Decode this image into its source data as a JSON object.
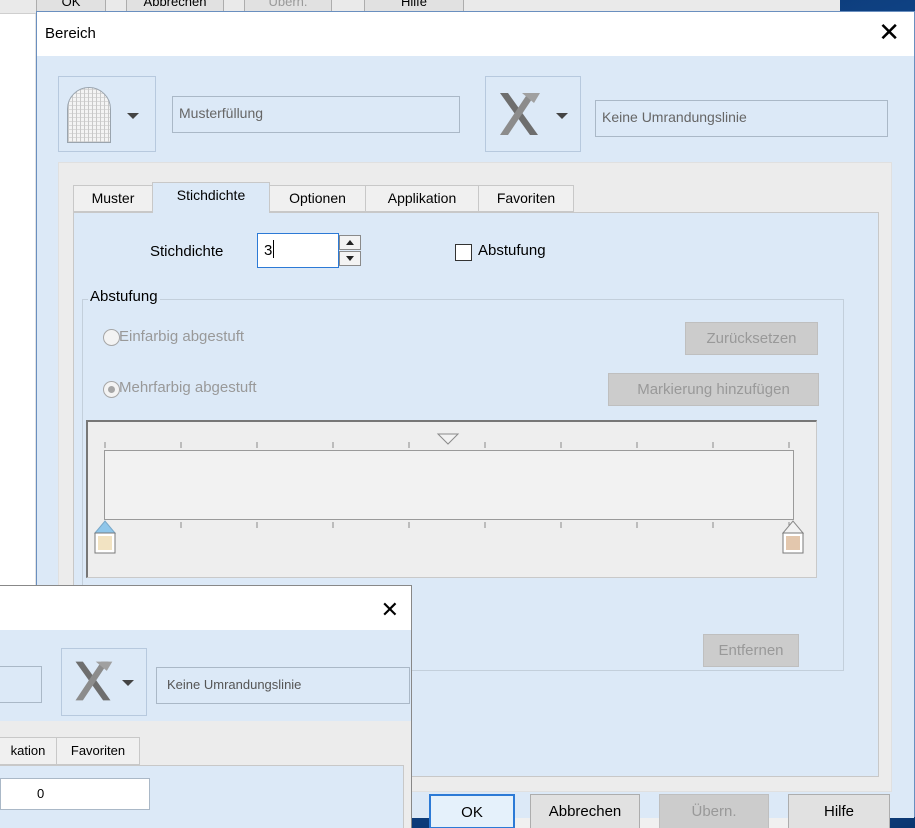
{
  "background_window": {
    "buttons": [
      "OK",
      "Abbrechen",
      "Übern.",
      "Hilfe"
    ]
  },
  "dialog": {
    "title": "Bereich",
    "pattern_fill_label": "Musterfüllung",
    "border_label": "Keine Umrandungslinie",
    "tabs": [
      {
        "label": "Muster",
        "active": false
      },
      {
        "label": "Stichdichte",
        "active": true
      },
      {
        "label": "Optionen",
        "active": false
      },
      {
        "label": "Applikation",
        "active": false
      },
      {
        "label": "Favoriten",
        "active": false
      }
    ],
    "stitch_density": {
      "label": "Stichdichte",
      "value": "3",
      "gradient_checkbox_label": "Abstufung",
      "gradient_checked": false
    },
    "gradient_group": {
      "title": "Abstufung",
      "single_color": "Einfarbig abgestuft",
      "multi_color": "Mehrfarbig abgestuft",
      "selected": "multi_color",
      "reset_button": "Zurücksetzen",
      "add_marker_button": "Markierung hinzufügen",
      "remove_button": "Entfernen"
    },
    "buttons": {
      "ok": "OK",
      "cancel": "Abbrechen",
      "apply": "Übern.",
      "help": "Hilfe"
    }
  },
  "dialog2": {
    "border_label": "Keine Umrandungslinie",
    "tabs": [
      "kation",
      "Favoriten"
    ],
    "value": "0"
  },
  "colors": {
    "client_bg": "#dce9f7",
    "accent": "#2c7ad6",
    "desktop": "#1a5ca8",
    "marker_left": "#f2e3c2",
    "marker_right": "#e3c7ad"
  }
}
